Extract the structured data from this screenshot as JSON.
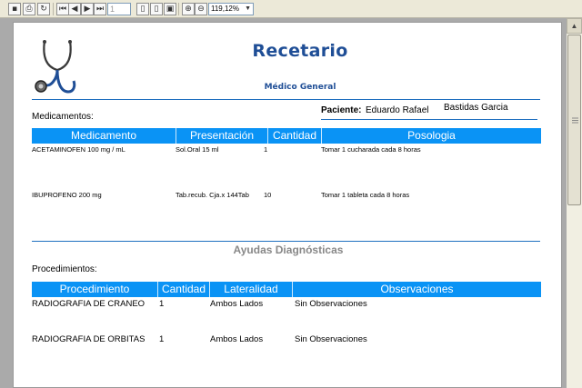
{
  "toolbar": {
    "page_number": "1",
    "zoom": "119,12%",
    "buttons": [
      "save-icon",
      "print-icon",
      "refresh-icon",
      "first-page-icon",
      "prev-page-icon",
      "next-page-icon",
      "last-page-icon",
      "single-page-icon",
      "double-page-icon",
      "fit-page-icon",
      "zoom-in-icon",
      "zoom-out-icon"
    ]
  },
  "report": {
    "title": "Recetario",
    "subtitle": "Médico General",
    "patient_label": "Paciente:",
    "patient_first_name": "Eduardo Rafael",
    "patient_last_name": "Bastidas Garcia",
    "medications_label": "Medicamentos:",
    "medications_headers": {
      "medicamento": "Medicamento",
      "presentacion": "Presentación",
      "cantidad": "Cantidad",
      "posologia": "Posologia"
    },
    "medications": [
      {
        "medicamento": "ACETAMINOFEN 100 mg / mL",
        "presentacion": "Sol.Oral 15 ml",
        "cantidad": "1",
        "posologia": "Tomar 1 cucharada cada 8 horas"
      },
      {
        "medicamento": "IBUPROFENO 200 mg",
        "presentacion": "Tab.recub. Cja.x 144Tab",
        "cantidad": "10",
        "posologia": "Tomar 1 tableta cada 8 horas"
      }
    ],
    "diagnostics_title": "Ayudas Diagnósticas",
    "procedures_label": "Procedimientos:",
    "procedures_headers": {
      "procedimiento": "Procedimiento",
      "cantidad": "Cantidad",
      "lateralidad": "Lateralidad",
      "observaciones": "Observaciones"
    },
    "procedures": [
      {
        "procedimiento": "RADIOGRAFIA DE CRANEO",
        "cantidad": "1",
        "lateralidad": "Ambos Lados",
        "observaciones": "Sin Observaciones"
      },
      {
        "procedimiento": "RADIOGRAFIA DE ORBITAS",
        "cantidad": "1",
        "lateralidad": "Ambos Lados",
        "observaciones": "Sin Observaciones"
      }
    ]
  },
  "colors": {
    "accent": "#1f4e96",
    "header_bar": "#0a93f5",
    "rule": "#1f6fbf"
  }
}
